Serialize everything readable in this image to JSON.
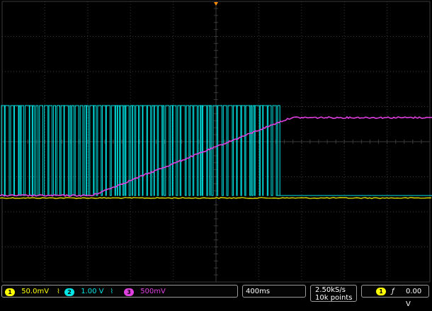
{
  "colors": {
    "background": "#000000",
    "grid": "#3a3a3a",
    "ch1": "#ffff00",
    "ch2": "#00e5e5",
    "ch3": "#e040e0",
    "trigger_marker": "#ff8c00"
  },
  "channels": [
    {
      "number": "1",
      "scale": "50.0mV",
      "coupling_icon": "bandwidth-limit-icon"
    },
    {
      "number": "2",
      "scale": "1.00 V",
      "coupling_icon": "bandwidth-limit-icon"
    },
    {
      "number": "3",
      "scale": "500mV"
    }
  ],
  "timebase": {
    "scale": "400ms"
  },
  "acquisition": {
    "rate": "2.50kS/s",
    "points": "10k points"
  },
  "trigger": {
    "source": "1",
    "slope_icon": "rising-edge-icon",
    "slope_symbol": "ƒ",
    "level": "0.00 V"
  }
}
